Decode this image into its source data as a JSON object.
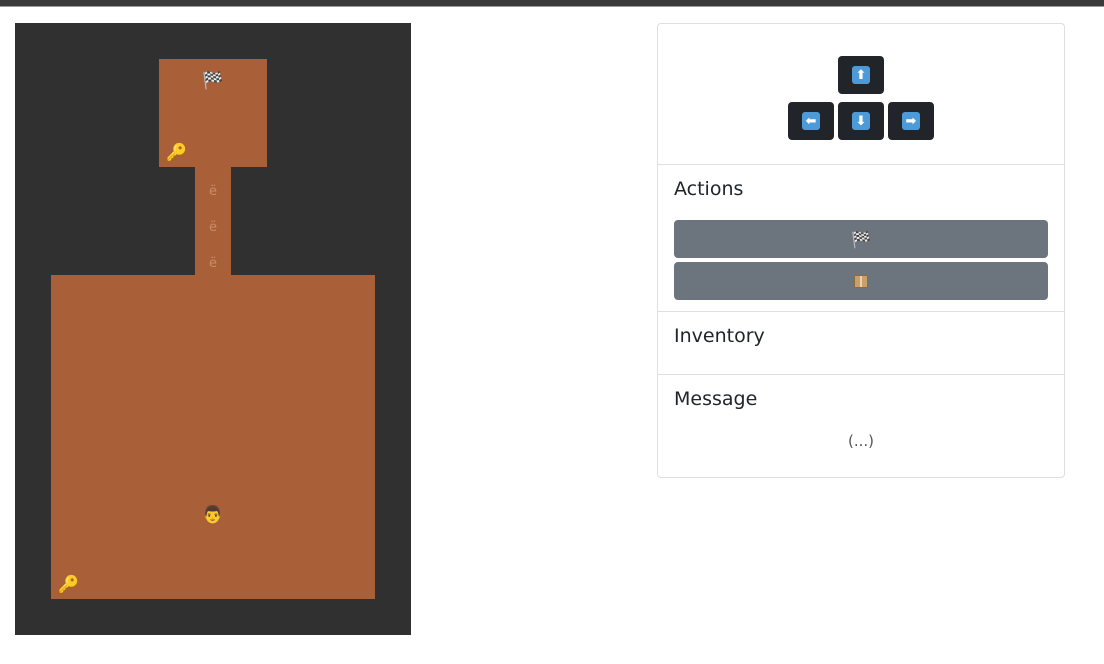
{
  "map": {
    "finish_icon": "🏁",
    "key_icon": "🔑",
    "player_icon": "👨",
    "door_icon": "ё"
  },
  "controls": {
    "up_label": "⬆",
    "left_label": "⬅",
    "down_label": "⬇",
    "right_label": "➡"
  },
  "actions": {
    "title": "Actions",
    "finish_label": "🏁"
  },
  "inventory": {
    "title": "Inventory"
  },
  "message": {
    "title": "Message",
    "text": "(...)"
  },
  "colors": {
    "wall": "#303030",
    "floor": "#a95f37",
    "key_button": "#212529",
    "action_button": "#6c757d"
  }
}
